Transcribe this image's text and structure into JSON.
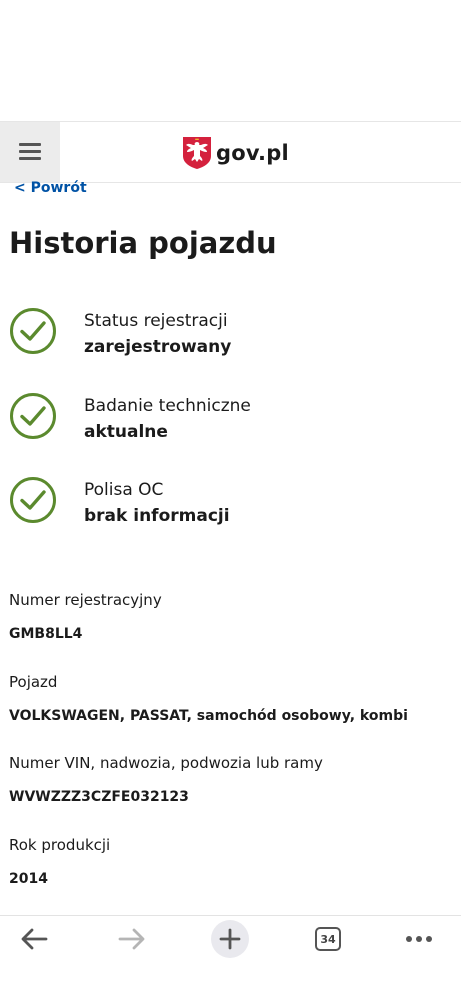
{
  "header": {
    "logo_text": "gov.pl",
    "emblem_icon": "polish-eagle-emblem-icon",
    "menu_icon": "hamburger-menu-icon"
  },
  "back_link": "< Powrót",
  "page_title": "Historia pojazdu",
  "statuses": [
    {
      "label": "Status rejestracji",
      "value": "zarejestrowany",
      "icon": "check-circle-icon"
    },
    {
      "label": "Badanie techniczne",
      "value": "aktualne",
      "icon": "check-circle-icon"
    },
    {
      "label": "Polisa OC",
      "value": "brak informacji",
      "icon": "check-circle-icon"
    }
  ],
  "details": [
    {
      "label": "Numer rejestracyjny",
      "value": "GMB8LL4"
    },
    {
      "label": "Pojazd",
      "value": "VOLKSWAGEN, PASSAT, samochód osobowy, kombi"
    },
    {
      "label": "Numer VIN, nadwozia, podwozia lub ramy",
      "value": "WVWZZZ3CZFE032123"
    },
    {
      "label": "Rok produkcji",
      "value": "2014"
    }
  ],
  "browser_bar": {
    "tab_count": "34",
    "icons": [
      "back-arrow-icon",
      "forward-arrow-icon",
      "new-tab-plus-icon",
      "tabs-counter-icon",
      "more-options-icon"
    ]
  },
  "colors": {
    "check_green": "#5b8a2e",
    "link_blue": "#0052a5",
    "emblem_red": "#d4213d"
  }
}
